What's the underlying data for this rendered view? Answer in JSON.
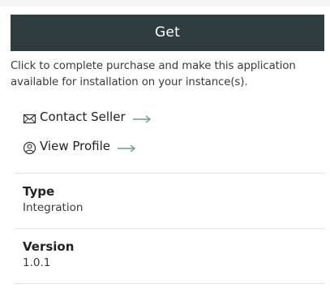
{
  "actions": {
    "get_label": "Get",
    "description": "Click to complete purchase and make this application available for installation on your instance(s).",
    "contact_seller_label": "Contact Seller",
    "view_profile_label": "View Profile"
  },
  "icons": {
    "contact": "envelope-icon",
    "profile": "user-circle-icon",
    "arrow": "arrow-right-icon"
  },
  "colors": {
    "button_bg": "#2f3d40",
    "arrow": "#6a9b8c"
  },
  "details": {
    "type_title": "Type",
    "type_value": "Integration",
    "version_title": "Version",
    "version_value": "1.0.1"
  }
}
